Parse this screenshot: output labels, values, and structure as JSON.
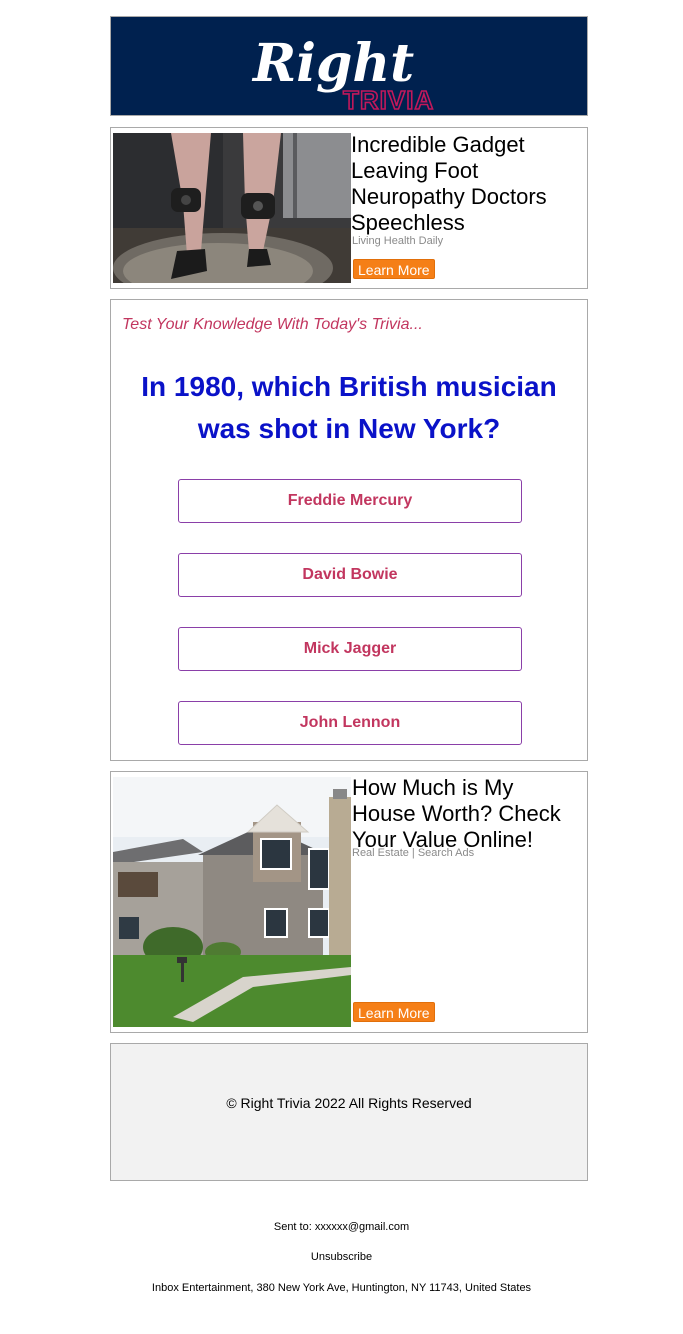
{
  "header": {
    "logo_script": "Right",
    "logo_word": "TRIVIA"
  },
  "ad1": {
    "title": "Incredible Gadget Leaving Foot Neuropathy Doctors Speechless",
    "source": "Living Health Daily",
    "button": "Learn More"
  },
  "trivia": {
    "intro": "Test Your Knowledge With Today's Trivia...",
    "question": "In 1980, which British musician was shot in New York?",
    "answers": [
      "Freddie Mercury",
      "David Bowie",
      "Mick Jagger",
      "John Lennon"
    ]
  },
  "ad2": {
    "title": "How Much is My House Worth? Check Your Value Online!",
    "source": "Real Estate | Search Ads",
    "button": "Learn More"
  },
  "footer": {
    "copyright": "© Right Trivia 2022 All Rights Reserved",
    "sent_to_label": "Sent to:",
    "sent_to_email": "xxxxxx@gmail.com",
    "unsubscribe": "Unsubscribe",
    "address": "Inbox Entertainment, 380 New York Ave, Huntington, NY 11743, United States"
  },
  "colors": {
    "header_bg": "#00214f",
    "accent_pink": "#c2365f",
    "question_blue": "#0a12c8",
    "button_orange": "#f57f17"
  }
}
